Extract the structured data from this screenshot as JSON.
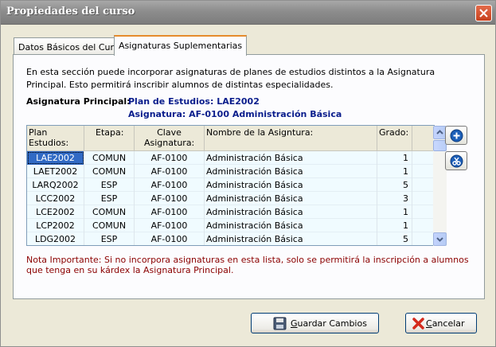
{
  "window": {
    "title": "Propiedades del curso"
  },
  "tabs": [
    "Datos Básicos del Curso",
    "Asignaturas Suplementarias"
  ],
  "description": "En esta sección puede incorporar asignaturas de planes de estudios distintos a la Asignatura Principal. Esto permitirá inscribir alumnos de distintas especialidades.",
  "principal": {
    "label": "Asignatura Principal:",
    "plan": "Plan de Estudios: LAE2002",
    "asignatura": "Asignatura: AF-0100 Administración Básica"
  },
  "grid": {
    "columns": [
      "Plan Estudios:",
      "Etapa:",
      "Clave Asignatura:",
      "Nombre de la Asigntura:",
      "Grado:"
    ],
    "rows": [
      {
        "plan": "LAE2002",
        "etapa": "COMUN",
        "clave": "AF-0100",
        "nombre": "Administración Básica",
        "grado": "1"
      },
      {
        "plan": "LAET2002",
        "etapa": "COMUN",
        "clave": "AF-0100",
        "nombre": "Administración Básica",
        "grado": "1"
      },
      {
        "plan": "LARQ2002",
        "etapa": "ESP",
        "clave": "AF-0100",
        "nombre": "Administración Básica",
        "grado": "5"
      },
      {
        "plan": "LCC2002",
        "etapa": "ESP",
        "clave": "AF-0100",
        "nombre": "Administración Básica",
        "grado": "3"
      },
      {
        "plan": "LCE2002",
        "etapa": "COMUN",
        "clave": "AF-0100",
        "nombre": "Administración Básica",
        "grado": "1"
      },
      {
        "plan": "LCP2002",
        "etapa": "COMUN",
        "clave": "AF-0100",
        "nombre": "Administración Básica",
        "grado": "1"
      },
      {
        "plan": "LDG2002",
        "etapa": "ESP",
        "clave": "AF-0100",
        "nombre": "Administración Básica",
        "grado": "5"
      }
    ]
  },
  "note": "Nota Importante: Si no incorpora asignaturas en esta lista, solo se permitirá la inscripción a alumnos que tenga en su kárdex la Asignatura Principal.",
  "buttons": {
    "save": {
      "first": "G",
      "rest": "uardar Cambios"
    },
    "cancel": {
      "first": "C",
      "rest": "ancelar"
    }
  },
  "icons": [
    "close-icon",
    "add-icon",
    "remove-icon",
    "save-icon",
    "cancel-icon"
  ]
}
